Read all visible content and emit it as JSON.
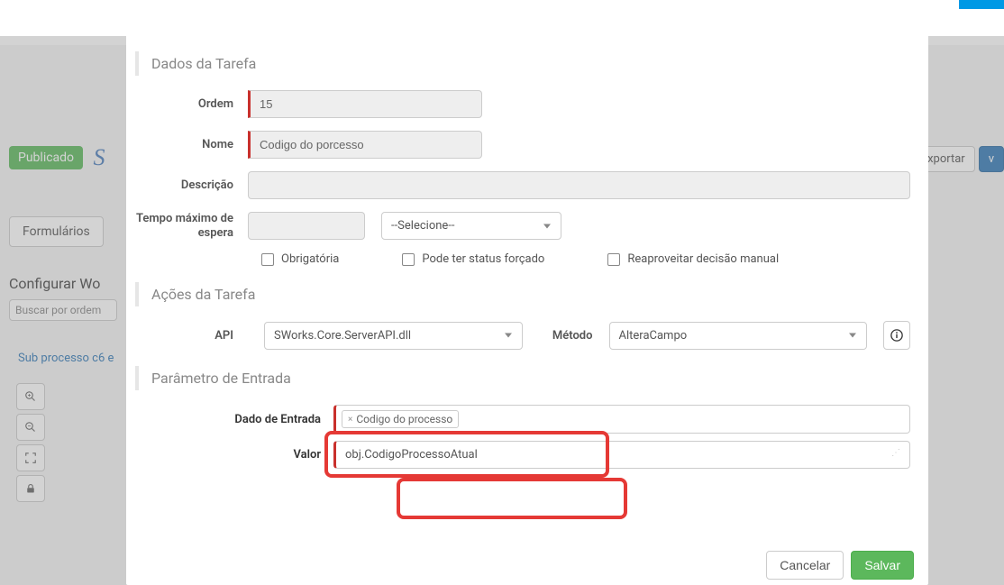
{
  "bg": {
    "published_badge": "Publicado",
    "title_letter": "S",
    "tab_formularios": "Formulários",
    "panel_title": "Configurar Wo",
    "search_placeholder": "Buscar por ordem",
    "subprocess_link": "Sub processo c6 e",
    "export_btn": "xportar",
    "v_btn": "v"
  },
  "sections": {
    "dados_tarefa": "Dados da Tarefa",
    "acoes_tarefa": "Ações da Tarefa",
    "parametro_entrada": "Parâmetro de Entrada"
  },
  "labels": {
    "ordem": "Ordem",
    "nome": "Nome",
    "descricao": "Descrição",
    "tempo_max": "Tempo máximo de espera",
    "api": "API",
    "metodo": "Método",
    "dado_entrada": "Dado de Entrada",
    "valor": "Valor"
  },
  "values": {
    "ordem": "15",
    "nome": "Codigo do porcesso",
    "descricao": "",
    "tempo_num": "",
    "tempo_unit": "--Selecione--",
    "api": "SWorks.Core.ServerAPI.dll",
    "metodo": "AlteraCampo",
    "dado_tag": "Codigo do processo",
    "valor": "obj.CodigoProcessoAtual"
  },
  "checkboxes": {
    "obrigatoria": "Obrigatória",
    "status_forcado": "Pode ter status forçado",
    "reaproveitar": "Reaproveitar decisão manual"
  },
  "footer": {
    "cancelar": "Cancelar",
    "salvar": "Salvar"
  }
}
